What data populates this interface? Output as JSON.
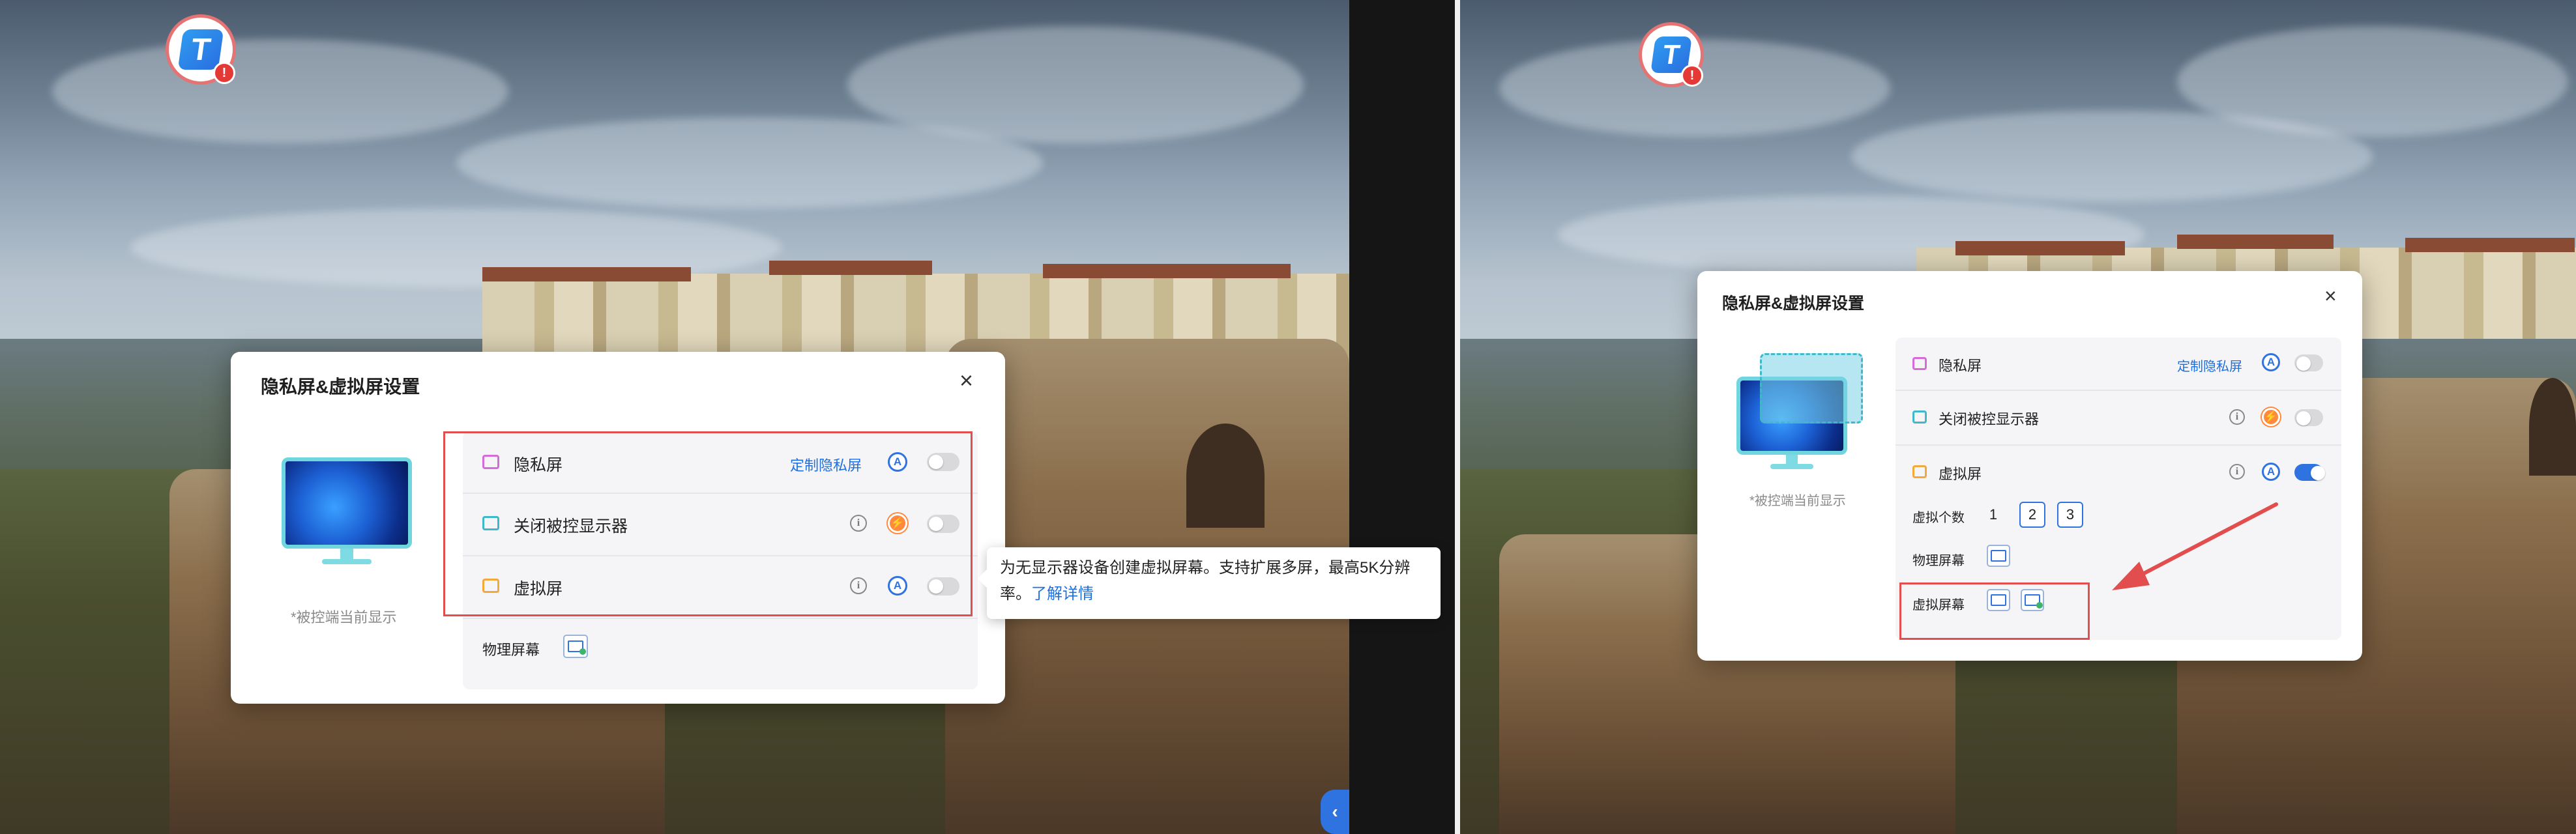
{
  "left": {
    "dialog": {
      "title": "隐私屏&虚拟屏设置",
      "hint": "*被控端当前显示",
      "rows": [
        {
          "label": "隐私屏",
          "link": "定制隐私屏",
          "badge": "A",
          "toggle": "off"
        },
        {
          "label": "关闭被控显示器",
          "info": "i",
          "badge": "⚡",
          "toggle": "off"
        },
        {
          "label": "虚拟屏",
          "info": "i",
          "badge": "A",
          "toggle": "off"
        }
      ],
      "physical_label": "物理屏幕"
    },
    "tooltip": {
      "text": "为无显示器设备创建虚拟屏幕。支持扩展多屏，最高5K分辨率。",
      "link": "了解详情"
    },
    "side_handle": "‹"
  },
  "right": {
    "dialog": {
      "title": "隐私屏&虚拟屏设置",
      "hint": "*被控端当前显示",
      "rows": [
        {
          "label": "隐私屏",
          "link": "定制隐私屏",
          "badge": "A",
          "toggle": "off"
        },
        {
          "label": "关闭被控显示器",
          "info": "i",
          "badge": "⚡",
          "toggle": "off"
        },
        {
          "label": "虚拟屏",
          "info": "i",
          "badge": "A",
          "toggle": "on"
        }
      ],
      "virtual_count_label": "虚拟个数",
      "virtual_counts": [
        "1",
        "2",
        "3"
      ],
      "physical_label": "物理屏幕",
      "virtual_label": "虚拟屏幕"
    }
  },
  "icons": {
    "logo": "T",
    "logo_alert": "!",
    "close": "×",
    "info": "i"
  },
  "colors": {
    "accent": "#2f73e0",
    "highlight": "#e24d4d",
    "link": "#1e6fe0"
  }
}
